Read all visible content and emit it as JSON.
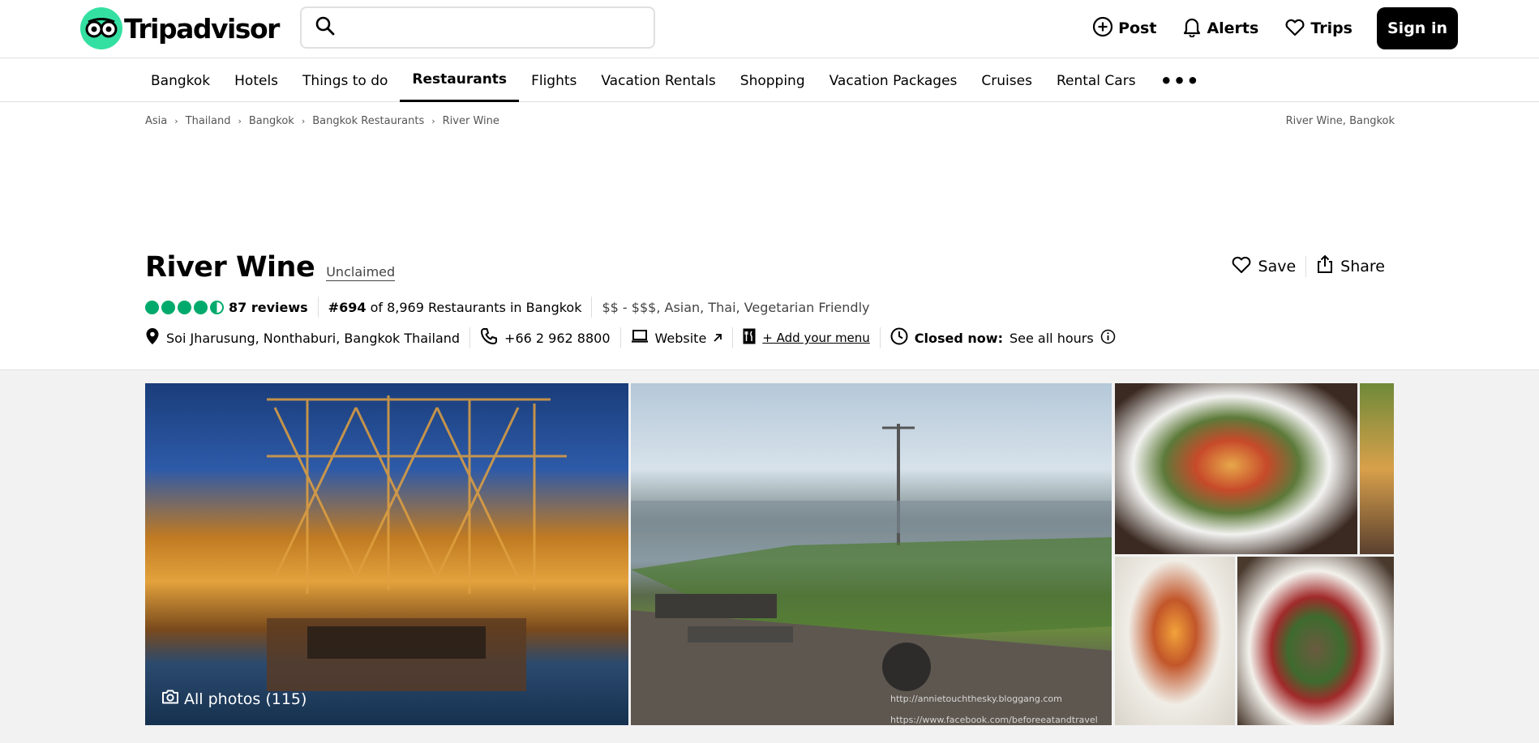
{
  "header": {
    "logo_text": "Tripadvisor",
    "search_placeholder": "",
    "post_label": "Post",
    "alerts_label": "Alerts",
    "trips_label": "Trips",
    "signin_label": "Sign in"
  },
  "nav": {
    "items": [
      "Bangkok",
      "Hotels",
      "Things to do",
      "Restaurants",
      "Flights",
      "Vacation Rentals",
      "Shopping",
      "Vacation Packages",
      "Cruises",
      "Rental Cars"
    ],
    "active": "Restaurants",
    "more": "•••"
  },
  "breadcrumb": {
    "items": [
      "Asia",
      "Thailand",
      "Bangkok",
      "Bangkok Restaurants",
      "River Wine"
    ],
    "right_label": "River Wine, Bangkok"
  },
  "restaurant": {
    "name": "River Wine",
    "claim_status": "Unclaimed",
    "save_label": "Save",
    "share_label": "Share",
    "rating": 4.5,
    "reviews": "87 reviews",
    "rank_strong": "#694",
    "rank_rest": "of 8,969 Restaurants in Bangkok",
    "price_cuisine": "$$ - $$$, Asian, Thai, Vegetarian Friendly",
    "address": "Soi Jharusung, Nonthaburi, Bangkok Thailand",
    "phone": "+66 2 962 8800",
    "website_label": "Website",
    "add_menu_label": "+ Add your menu",
    "hours_status": "Closed now:",
    "hours_link": "See all hours"
  },
  "gallery": {
    "all_photos_label": "All photos (115)",
    "watermark_1": "http://annietouchthesky.bloggang.com",
    "watermark_2": "https://www.facebook.com/beforeeatandtravel"
  },
  "colors": {
    "brand_green": "#34e0a1",
    "bubble_green": "#00aa6c"
  }
}
